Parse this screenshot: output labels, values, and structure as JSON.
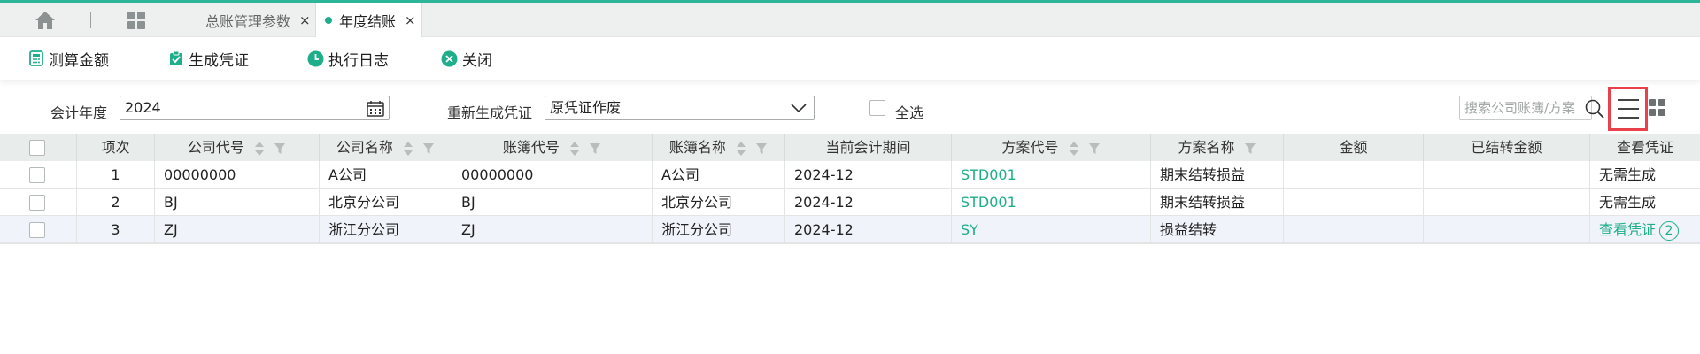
{
  "tabs": [
    {
      "label": "总账管理参数",
      "close": "×"
    },
    {
      "label": "年度结账",
      "close": "×"
    }
  ],
  "toolbar": {
    "calc": "测算金额",
    "gen": "生成凭证",
    "log": "执行日志",
    "close": "关闭"
  },
  "filters": {
    "year_label": "会计年度",
    "year_value": "2024",
    "regen_label": "重新生成凭证",
    "regen_value": "原凭证作废",
    "select_all": "全选",
    "search_placeholder": "搜索公司账簿/方案"
  },
  "table": {
    "headers": [
      "项次",
      "公司代号",
      "公司名称",
      "账簿代号",
      "账簿名称",
      "当前会计期间",
      "方案代号",
      "方案名称",
      "金额",
      "已结转金额",
      "查看凭证"
    ],
    "rows": [
      {
        "idx": "1",
        "company_code": "00000000",
        "company_name": "A公司",
        "book_code": "00000000",
        "book_name": "A公司",
        "period": "2024-12",
        "plan_code": "STD001",
        "plan_name": "期末结转损益",
        "amount": "",
        "carried": "",
        "voucher": "无需生成",
        "badge": ""
      },
      {
        "idx": "2",
        "company_code": "BJ",
        "company_name": "北京分公司",
        "book_code": "BJ",
        "book_name": "北京分公司",
        "period": "2024-12",
        "plan_code": "STD001",
        "plan_name": "期末结转损益",
        "amount": "",
        "carried": "",
        "voucher": "无需生成",
        "badge": ""
      },
      {
        "idx": "3",
        "company_code": "ZJ",
        "company_name": "浙江分公司",
        "book_code": "ZJ",
        "book_name": "浙江分公司",
        "period": "2024-12",
        "plan_code": "SY",
        "plan_name": "损益结转",
        "amount": "",
        "carried": "",
        "voucher": "查看凭证",
        "badge": "2"
      }
    ]
  },
  "colors": {
    "accent": "#1fae8a",
    "highlight": "#e8414c"
  }
}
